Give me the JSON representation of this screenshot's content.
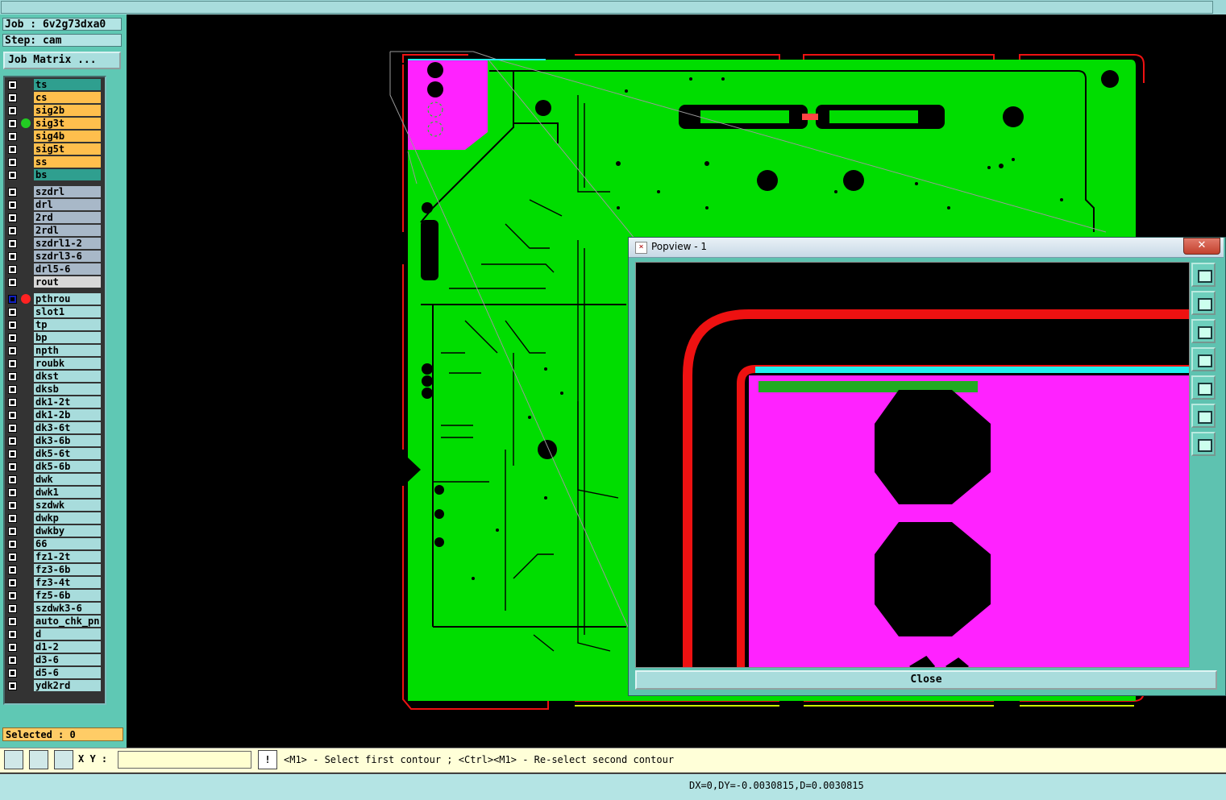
{
  "job": "Job : 6v2g73dxa0",
  "step": "Step: cam",
  "job_matrix_label": "Job Matrix ...",
  "layers_board": [
    {
      "name": "ts",
      "bg": "#2f9f8f"
    },
    {
      "name": "cs",
      "bg": "#ffbf4d"
    },
    {
      "name": "sig2b",
      "bg": "#ffbf4d"
    },
    {
      "name": "sig3t",
      "bg": "#ffbf4d",
      "dot": "#22cc22"
    },
    {
      "name": "sig4b",
      "bg": "#ffbf4d"
    },
    {
      "name": "sig5t",
      "bg": "#ffbf4d"
    },
    {
      "name": "ss",
      "bg": "#ffbf4d"
    },
    {
      "name": "bs",
      "bg": "#2f9f8f"
    }
  ],
  "layers_drill": [
    {
      "name": "szdrl",
      "bg": "#a8b8c8"
    },
    {
      "name": "drl",
      "bg": "#a8b8c8"
    },
    {
      "name": "2rd",
      "bg": "#a8b8c8"
    },
    {
      "name": "2rdl",
      "bg": "#a8b8c8"
    },
    {
      "name": "szdrl1-2",
      "bg": "#a8b8c8"
    },
    {
      "name": "szdrl3-6",
      "bg": "#a8b8c8"
    },
    {
      "name": "drl5-6",
      "bg": "#a8b8c8"
    },
    {
      "name": "rout",
      "bg": "#d8d8d8"
    }
  ],
  "layers_misc": [
    "pthrou",
    "slot1",
    "tp",
    "bp",
    "npth",
    "roubk",
    "dkst",
    "dksb",
    "dk1-2t",
    "dk1-2b",
    "dk3-6t",
    "dk3-6b",
    "dk5-6t",
    "dk5-6b",
    "dwk",
    "dwk1",
    "szdwk",
    "dwkp",
    "dwkby",
    "66",
    "fz1-2t",
    "fz3-6b",
    "fz3-4t",
    "fz5-6b",
    "szdwk3-6",
    "auto_chk_pn",
    "d",
    "d1-2",
    "d3-6",
    "d5-6",
    "ydk2rd"
  ],
  "misc_bg": "#a8dcdc",
  "active_layer_dot": "#ff2222",
  "selected_label": "Selected : 0",
  "xy_label": "X Y :",
  "xy_value": "",
  "exclaim": "!",
  "hint": "<M1> - Select first contour ; <Ctrl><M1> - Re-select second contour",
  "status": "DX=0,DY=-0.0030815,D=0.0030815",
  "popview": {
    "title": "Popview - 1",
    "close_x": "✕",
    "close_button": "Close",
    "side_buttons": [
      "zoom-fit-icon",
      "pan-up-icon",
      "pan-down-icon",
      "pan-left-icon",
      "pan-right-icon",
      "zoom-out-icon",
      "zoom-in-icon"
    ]
  },
  "colors": {
    "board_green": "#00dd00",
    "profile_red": "#ee1111",
    "pad_magenta": "#ff22ff",
    "outline_cyan": "#22eeee",
    "panel_teal": "#5fc8b4"
  }
}
